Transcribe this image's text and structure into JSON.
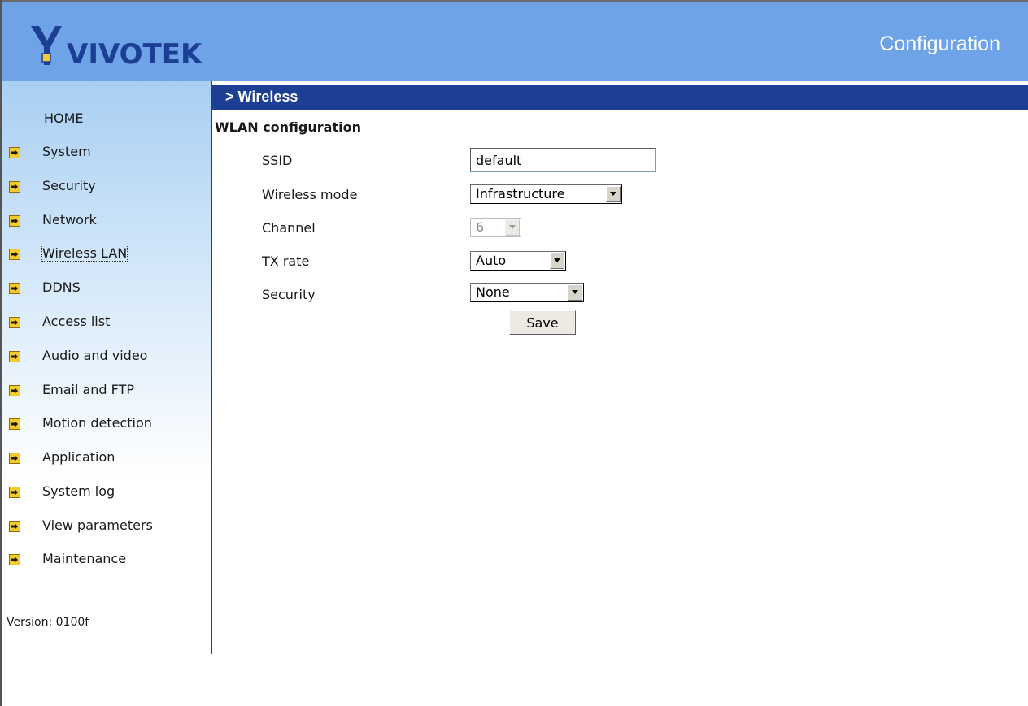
{
  "header": {
    "brand": "VIVOTEK",
    "title": "Configuration",
    "background_color": "#6fa3e8"
  },
  "sidebar": {
    "home_label": "HOME",
    "items": [
      {
        "label": "System",
        "icon": "arrow-right-icon"
      },
      {
        "label": "Security",
        "icon": "arrow-right-icon"
      },
      {
        "label": "Network",
        "icon": "arrow-right-icon"
      },
      {
        "label": "Wireless LAN",
        "icon": "arrow-right-icon",
        "active": true
      },
      {
        "label": "DDNS",
        "icon": "arrow-right-icon"
      },
      {
        "label": "Access list",
        "icon": "arrow-right-icon"
      },
      {
        "label": "Audio and video",
        "icon": "arrow-right-icon"
      },
      {
        "label": "Email and FTP",
        "icon": "arrow-right-icon"
      },
      {
        "label": "Motion detection",
        "icon": "arrow-right-icon"
      },
      {
        "label": "Application",
        "icon": "arrow-right-icon"
      },
      {
        "label": "System log",
        "icon": "arrow-right-icon"
      },
      {
        "label": "View parameters",
        "icon": "arrow-right-icon"
      },
      {
        "label": "Maintenance",
        "icon": "arrow-right-icon"
      }
    ],
    "version": "Version: 0100f"
  },
  "page": {
    "breadcrumb": "> Wireless",
    "bar_color": "#1c3f93",
    "section_title": "WLAN configuration"
  },
  "form": {
    "ssid_label": "SSID",
    "ssid_value": "default",
    "wireless_mode_label": "Wireless mode",
    "wireless_mode_value": "Infrastructure",
    "channel_label": "Channel",
    "channel_value": "6",
    "tx_rate_label": "TX rate",
    "tx_rate_value": "Auto",
    "security_label": "Security",
    "security_value": "None",
    "save_label": "Save"
  }
}
